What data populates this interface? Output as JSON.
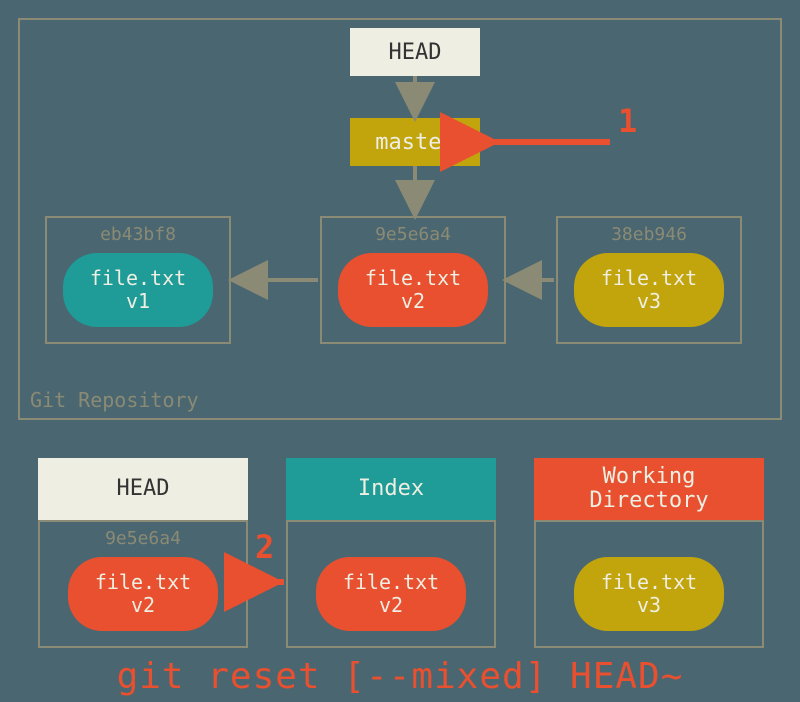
{
  "repo_label": "Git Repository",
  "head_label": "HEAD",
  "master_label": "master",
  "commits": [
    {
      "hash": "eb43bf8",
      "file": "file.txt",
      "ver": "v1"
    },
    {
      "hash": "9e5e6a4",
      "file": "file.txt",
      "ver": "v2"
    },
    {
      "hash": "38eb946",
      "file": "file.txt",
      "ver": "v3"
    }
  ],
  "bottom": {
    "head": {
      "label": "HEAD",
      "hash": "9e5e6a4",
      "file": "file.txt",
      "ver": "v2"
    },
    "index": {
      "label": "Index",
      "file": "file.txt",
      "ver": "v2"
    },
    "wd": {
      "label": "Working\nDirectory",
      "file": "file.txt",
      "ver": "v3"
    }
  },
  "steps": {
    "one": "1",
    "two": "2"
  },
  "command": "git reset [--mixed] HEAD~",
  "colors": {
    "bg": "#4a6670",
    "border": "#8a8a75",
    "cream": "#eeeee2",
    "teal": "#1f9b98",
    "red": "#e8502f",
    "gold": "#c2a50d"
  }
}
